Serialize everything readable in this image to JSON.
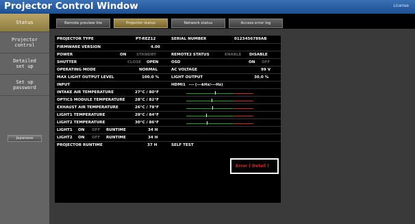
{
  "app": {
    "title": "Projector Control Window",
    "license_label": "License"
  },
  "sidebar": {
    "items": [
      {
        "label": "Status"
      },
      {
        "label": "Projector\ncontrol"
      },
      {
        "label": "Detailed\nset up"
      },
      {
        "label": "Set up\npassword"
      }
    ],
    "language_button": "Japanese"
  },
  "tabs": [
    {
      "label": "Remote preview lite"
    },
    {
      "label": "Projector status"
    },
    {
      "label": "Network status"
    },
    {
      "label": "Access error log"
    }
  ],
  "status": {
    "projector_type": {
      "label": "PROJECTOR TYPE",
      "value": "PT-REZ12"
    },
    "serial_number": {
      "label": "SERIAL NUMBER",
      "value": "0123456789AB"
    },
    "firmware_version": {
      "label": "FIRMWARE VERSION",
      "value": "4.00"
    },
    "power": {
      "label": "POWER",
      "on": "ON",
      "standby": "STANDBY"
    },
    "remote2_status": {
      "label": "REMOTE2 STATUS",
      "enable": "ENABLE",
      "disable": "DISABLE"
    },
    "shutter": {
      "label": "SHUTTER",
      "close": "CLOSE",
      "open": "OPEN"
    },
    "osd": {
      "label": "OSD",
      "on": "ON",
      "off": "OFF"
    },
    "operating_mode": {
      "label": "OPERATING MODE",
      "value": "NORMAL"
    },
    "ac_voltage": {
      "label": "AC VOLTAGE",
      "value": "99 V"
    },
    "max_light_output_level": {
      "label": "MAX LIGHT OUTPUT LEVEL",
      "value": "100.0 %"
    },
    "light_output": {
      "label": "LIGHT OUTPUT",
      "value": "30.0 %"
    },
    "input": {
      "label": "INPUT",
      "value": "HDMI1",
      "signal": "--- (---kHz/---Hz)"
    },
    "temperatures": [
      {
        "label": "INTAKE AIR TEMPERATURE",
        "value": "27°C / 80°F",
        "marker_fraction": 0.43
      },
      {
        "label": "OPTICS MODULE TEMPERATURE",
        "value": "28°C / 82°F",
        "marker_fraction": 0.38
      },
      {
        "label": "EXHAUST AIR TEMPERATURE",
        "value": "26°C / 78°F",
        "marker_fraction": 0.39
      },
      {
        "label": "LIGHT1 TEMPERATURE",
        "value": "29°C / 84°F",
        "marker_fraction": 0.3
      },
      {
        "label": "LIGHT2 TEMPERATURE",
        "value": "30°C / 86°F",
        "marker_fraction": 0.31
      }
    ],
    "lights": [
      {
        "label": "LIGHT1",
        "on": "ON",
        "off": "OFF",
        "runtime_label": "RUNTIME",
        "runtime": "34 H"
      },
      {
        "label": "LIGHT2",
        "on": "ON",
        "off": "OFF",
        "runtime_label": "RUNTIME",
        "runtime": "34 H"
      }
    ],
    "projector_runtime": {
      "label": "PROJECTOR RUNTIME",
      "value": "37 H"
    },
    "self_test": {
      "label": "SELF TEST",
      "value": "Error ( Detail )"
    }
  },
  "colors": {
    "accent": "#b9a567",
    "error": "#e02828",
    "gauge_green": "#1da51d",
    "gauge_red": "#d42525"
  }
}
